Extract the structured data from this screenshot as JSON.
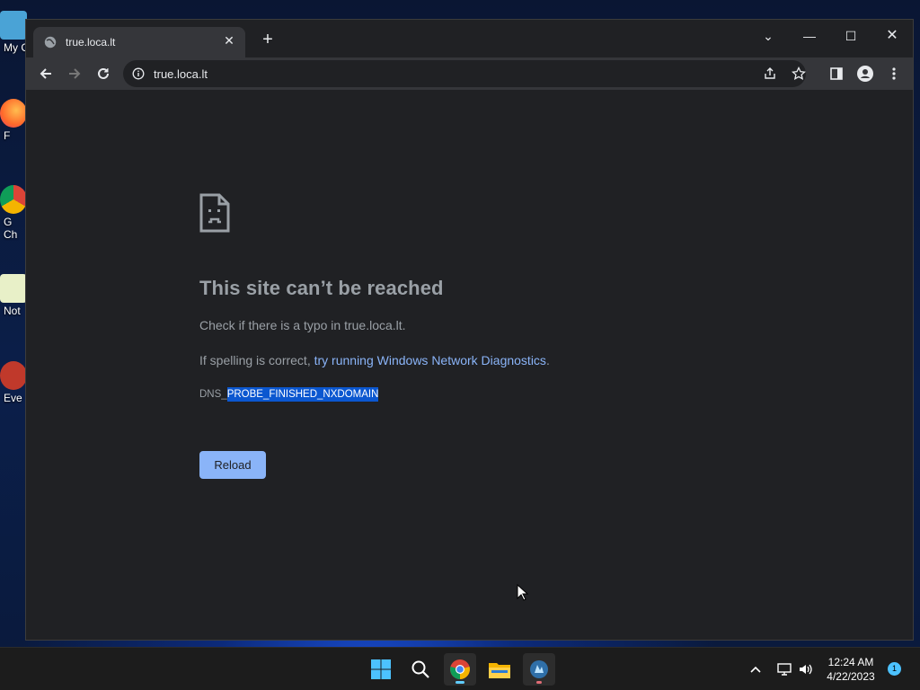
{
  "desktop": {
    "icons": [
      {
        "label": "My C",
        "icon": "this-pc-icon"
      },
      {
        "label": "F",
        "icon": "firefox-icon"
      },
      {
        "label": "G",
        "label2": "Ch",
        "icon": "chrome-icon"
      },
      {
        "label": "Not",
        "icon": "notepad-icon"
      },
      {
        "label": "Eve",
        "icon": "app-icon"
      }
    ]
  },
  "browser": {
    "tab": {
      "title": "true.loca.lt",
      "favicon": "globe-icon"
    },
    "new_tab_symbol": "+",
    "window_controls": {
      "tab_search": "⌄",
      "minimize": "—",
      "maximize": "☐",
      "close": "✕"
    },
    "url": "true.loca.lt"
  },
  "error_page": {
    "title": "This site can’t be reached",
    "line1": "Check if there is a typo in true.loca.lt.",
    "line2_prefix": "If spelling is correct, ",
    "line2_link": "try running Windows Network Diagnostics",
    "line2_suffix": ".",
    "code_prefix": "DNS_",
    "code_selected": "PROBE_FINISHED_NXDOMAIN",
    "reload_label": "Reload"
  },
  "taskbar": {
    "items": [
      "start-icon",
      "search-icon",
      "chrome-icon",
      "file-explorer-icon",
      "app-icon"
    ],
    "clock_time": "12:24 AM",
    "clock_date": "4/22/2023",
    "notification_count": "1"
  },
  "colors": {
    "page_bg": "#202124",
    "toolbar_bg": "#35363a",
    "link": "#8ab4f8",
    "selection": "#0b57d0",
    "button": "#8ab4f8"
  }
}
